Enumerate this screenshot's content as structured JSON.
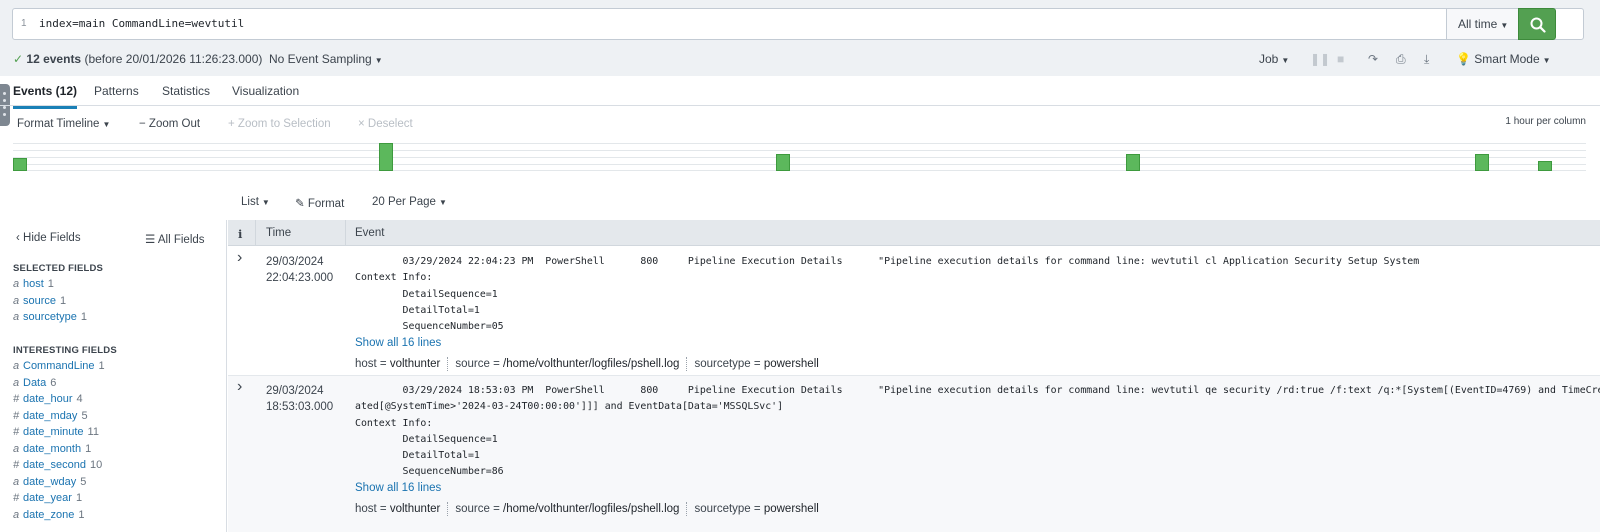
{
  "search": {
    "line_number": "1",
    "query": "index=main CommandLine=wevtutil",
    "time_range": "All time"
  },
  "status": {
    "event_count": "12 events",
    "before": "(before 20/01/2026 11:26:23.000)",
    "sampling": "No Event Sampling",
    "job": "Job",
    "mode": "Smart Mode"
  },
  "tabs": [
    "Events (12)",
    "Patterns",
    "Statistics",
    "Visualization"
  ],
  "timeline": {
    "format": "Format Timeline",
    "zoom_out": "Zoom Out",
    "zoom_selection": "Zoom to Selection",
    "deselect": "Deselect",
    "scale": "1 hour per column",
    "bars": [
      0.45,
      1.0,
      0.62,
      0.62,
      0.62,
      0.35
    ]
  },
  "results_toolbar": {
    "list": "List",
    "format": "Format",
    "per_page": "20 Per Page"
  },
  "sidebar": {
    "hide_fields": "Hide Fields",
    "all_fields": "All Fields",
    "selected_heading": "SELECTED FIELDS",
    "selected": [
      {
        "type": "a",
        "name": "host",
        "count": "1"
      },
      {
        "type": "a",
        "name": "source",
        "count": "1"
      },
      {
        "type": "a",
        "name": "sourcetype",
        "count": "1"
      }
    ],
    "interesting_heading": "INTERESTING FIELDS",
    "interesting": [
      {
        "type": "a",
        "name": "CommandLine",
        "count": "1"
      },
      {
        "type": "a",
        "name": "Data",
        "count": "6"
      },
      {
        "type": "#",
        "name": "date_hour",
        "count": "4"
      },
      {
        "type": "#",
        "name": "date_mday",
        "count": "5"
      },
      {
        "type": "#",
        "name": "date_minute",
        "count": "11"
      },
      {
        "type": "a",
        "name": "date_month",
        "count": "1"
      },
      {
        "type": "#",
        "name": "date_second",
        "count": "10"
      },
      {
        "type": "a",
        "name": "date_wday",
        "count": "5"
      },
      {
        "type": "#",
        "name": "date_year",
        "count": "1"
      },
      {
        "type": "a",
        "name": "date_zone",
        "count": "1"
      }
    ]
  },
  "table": {
    "col_info": "i",
    "col_time": "Time",
    "col_event": "Event"
  },
  "events": [
    {
      "date": "29/03/2024",
      "time": "22:04:23.000",
      "raw": "        03/29/2024 22:04:23 PM  PowerShell      800     Pipeline Execution Details      \"Pipeline execution details for command line: wevtutil cl Application Security Setup System\nContext Info:\n        DetailSequence=1\n        DetailTotal=1\n        SequenceNumber=05",
      "show_all": "Show all 16 lines",
      "host_label": "host =",
      "host": "volthunter",
      "source_label": "source =",
      "source": "/home/volthunter/logfiles/pshell.log",
      "sourcetype_label": "sourcetype =",
      "sourcetype": "powershell"
    },
    {
      "date": "29/03/2024",
      "time": "18:53:03.000",
      "raw": "        03/29/2024 18:53:03 PM  PowerShell      800     Pipeline Execution Details      \"Pipeline execution details for command line: wevtutil qe security /rd:true /f:text /q:*[System[(EventID=4769) and TimeCre\nated[@SystemTime>'2024-03-24T00:00:00']]] and EventData[Data='MSSQLSvc']\nContext Info:\n        DetailSequence=1\n        DetailTotal=1\n        SequenceNumber=86",
      "show_all": "Show all 16 lines",
      "host_label": "host =",
      "host": "volthunter",
      "source_label": "source =",
      "source": "/home/volthunter/logfiles/pshell.log",
      "sourcetype_label": "sourcetype =",
      "sourcetype": "powershell"
    }
  ]
}
